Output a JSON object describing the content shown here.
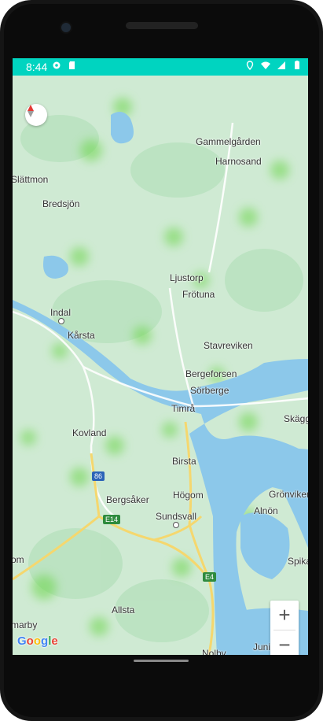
{
  "status_bar": {
    "time": "8:44",
    "left_icons": [
      "gear-icon",
      "sd-card-icon"
    ],
    "right_icons": [
      "location-icon",
      "wifi-icon",
      "signal-icon",
      "battery-icon"
    ],
    "bg_color": "#00d4c0"
  },
  "map": {
    "places": [
      {
        "key": "gammelgarden",
        "label": "Gammelgården"
      },
      {
        "key": "harnosand",
        "label": "Harnosand"
      },
      {
        "key": "slattmon",
        "label": "Slättmon"
      },
      {
        "key": "bredsjon",
        "label": "Bredsjön"
      },
      {
        "key": "ljustorp",
        "label": "Ljustorp"
      },
      {
        "key": "frotuna",
        "label": "Frötuna"
      },
      {
        "key": "indal",
        "label": "Indal"
      },
      {
        "key": "karsta",
        "label": "Kårsta"
      },
      {
        "key": "stavreviken",
        "label": "Stavreviken"
      },
      {
        "key": "bergeforsen",
        "label": "Bergeforsen"
      },
      {
        "key": "sorberge",
        "label": "Sörberge"
      },
      {
        "key": "timra",
        "label": "Timrå"
      },
      {
        "key": "skagg",
        "label": "Skägg"
      },
      {
        "key": "kovland",
        "label": "Kovland"
      },
      {
        "key": "birsta",
        "label": "Birsta"
      },
      {
        "key": "hogom",
        "label": "Högom"
      },
      {
        "key": "bergsaker",
        "label": "Bergsåker"
      },
      {
        "key": "gronviken",
        "label": "Grönviken"
      },
      {
        "key": "alno",
        "label": "Alnön"
      },
      {
        "key": "sundsvall",
        "label": "Sundsvall"
      },
      {
        "key": "om",
        "label": "om"
      },
      {
        "key": "spika",
        "label": "Spika"
      },
      {
        "key": "allsta",
        "label": "Allsta"
      },
      {
        "key": "marby",
        "label": "marby"
      },
      {
        "key": "juniskar",
        "label": "Juniskär"
      },
      {
        "key": "nolby",
        "label": "Nolby"
      }
    ],
    "road_shields": [
      {
        "key": "r86",
        "label": "86",
        "color": "#2b63b8"
      },
      {
        "key": "e14",
        "label": "E14",
        "color": "#2e8b3e"
      },
      {
        "key": "e4",
        "label": "E4",
        "color": "#2e8b3e"
      }
    ],
    "compass_icon": "compass-icon",
    "zoom_in_label": "+",
    "zoom_out_label": "−",
    "attribution": {
      "letters": [
        "G",
        "o",
        "o",
        "g",
        "l",
        "e"
      ],
      "colors": [
        "#4285F4",
        "#EA4335",
        "#FBBC05",
        "#4285F4",
        "#34A853",
        "#EA4335"
      ]
    }
  },
  "colors": {
    "water": "#8cc8ea",
    "land": "#cfead3",
    "heatmap": "#6bd54a",
    "road_major": "#f5d76e"
  }
}
